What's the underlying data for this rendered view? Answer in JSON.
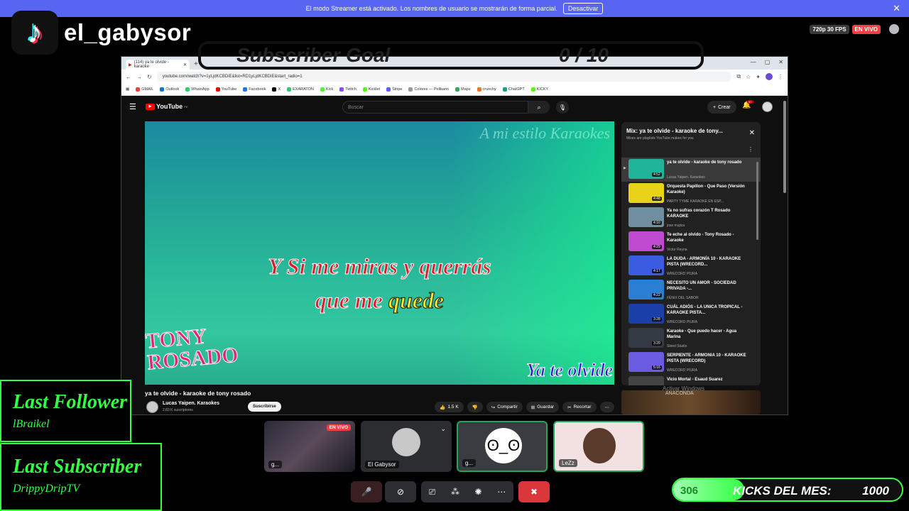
{
  "streamer_banner": {
    "message": "El modo Streamer está activado. Los nombres de usuario se mostrarán de forma parcial.",
    "button": "Desactivar"
  },
  "tiktok": {
    "username": "el_gabysor"
  },
  "stream_stats": {
    "resolution": "720p 30 FPS",
    "live": "EN VIVO"
  },
  "browser": {
    "tab_title": "(114) ya te olvide - karaoke",
    "url": "youtube.com/watch?v=1yLjdKCBDiE&list=RD1yLjdKCBDiE&start_radio=1",
    "bookmarks": [
      "GMAIL",
      "Outlook",
      "WhatsApp",
      "YouTube",
      "Facebook",
      "X",
      "EXARATON",
      "Kick",
      "Twitch",
      "Kicklet",
      "Stripe",
      "Colores — Pelikano",
      "Maps",
      "crunchy",
      "ChatGPT",
      "KICKY"
    ],
    "overlay_goal_text": "Subscriber Goal",
    "overlay_goal_count": "0 / 10"
  },
  "youtube": {
    "logo": "YouTube",
    "region": "PE",
    "search_placeholder": "Buscar",
    "create_label": "Crear",
    "notif_count": "9+",
    "video": {
      "watermark": "A mi estilo Karaokes",
      "lyric_line1": "Y Si me miras y querrás",
      "lyric_line2_a": "que me ",
      "lyric_line2_b": "quede",
      "artist_line1": "TONY",
      "artist_line2": "ROSADO",
      "song_title": "Ya te olvide"
    },
    "title": "ya te olvide - karaoke de tony rosado",
    "channel": "Lucas Yaipen. Karaokes",
    "subscribers": "2.83 K suscriptores",
    "subscribe": "Suscribirse",
    "likes": "1.5 K",
    "share": "Compartir",
    "save": "Guardar",
    "clip": "Recortar",
    "playlist": {
      "title": "Mix: ya te olvide - karaoke de tony...",
      "subtitle": "Mixes are playlists YouTube makes for you",
      "items": [
        {
          "title": "ya te olvide - karaoke de tony rosado",
          "by": "Lucas Yaipen. Karaokes",
          "dur": "4:52",
          "color": "#1fb39a"
        },
        {
          "title": "Orquesta Papillon - Que Paso (Versión Karaoke)",
          "by": "PARTY TYME KARAOKE EN ESP...",
          "dur": "4:48",
          "color": "#e8d21a"
        },
        {
          "title": "Ya no sufras corazón T Rosado KARAOKE",
          "by": "jose mujica",
          "dur": "4:10",
          "color": "#6f8f9f"
        },
        {
          "title": "Te eche al olvido - Tony Rosado - Karaoke",
          "by": "Victor Reyna",
          "dur": "4:29",
          "color": "#c04bd1"
        },
        {
          "title": "LA DUDA - ARMONÍA 10 - KARAOKE PISTA (WRECORD...",
          "by": "WRECORD PIURA",
          "dur": "4:17",
          "color": "#3b5be0"
        },
        {
          "title": "NECESITO UN AMOR - SOCIEDAD PRIVADA -...",
          "by": "FÉNIX DEL SABOR",
          "dur": "4:22",
          "color": "#2a7fd4"
        },
        {
          "title": "CUÁL ADIÓS - LA UNICA TROPICAL - KARAOKE PISTA...",
          "by": "WRECORD PIURA",
          "dur": "3:28",
          "color": "#1a3fa8"
        },
        {
          "title": "Karaoke - Que puedo hacer - Agua Marina",
          "by": "Sleed Studio",
          "dur": "3:20",
          "color": "#333a44"
        },
        {
          "title": "SERPIENTE - ARMONIA 10 - KARAOKE PISTA (WRECORD)",
          "by": "WRECORD PIURA",
          "dur": "5:16",
          "color": "#6a5be0"
        },
        {
          "title": "Vicio Mortal - Esaud Suarez",
          "by": "",
          "dur": "",
          "color": "#444"
        }
      ]
    },
    "ad_label": "ANACONDA",
    "windows_notice": "Activar Windows"
  },
  "overlays": {
    "last_follower_title": "Last Follower",
    "last_follower_name": "lBraikel",
    "last_subscriber_title": "Last Subscriber",
    "last_subscriber_name": "DrippyDripTV"
  },
  "discord": {
    "tiles": [
      {
        "label": "g...",
        "live": "EN VIVO"
      },
      {
        "label": "El Gabysor"
      },
      {
        "label": "g..."
      },
      {
        "label": "LeZz"
      }
    ]
  },
  "kicks": {
    "current": "306",
    "label": "KICKS DEL MES:",
    "goal": "1000",
    "progress": 0.306
  }
}
